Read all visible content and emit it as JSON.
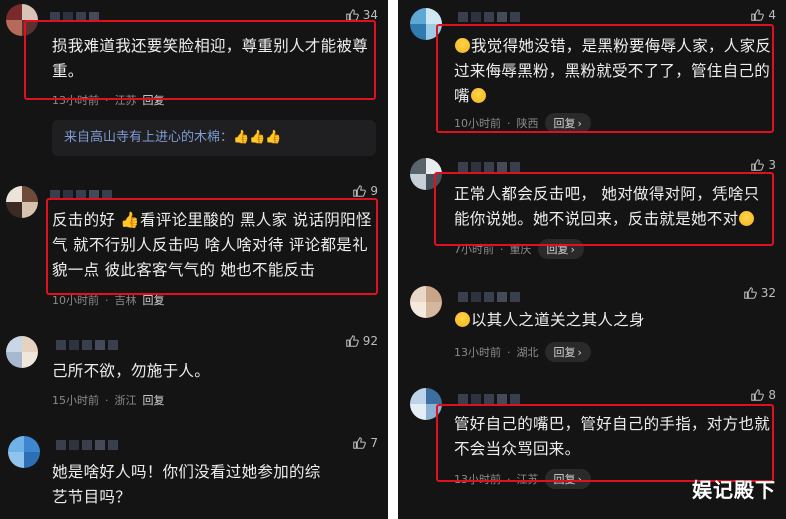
{
  "left": {
    "comments": [
      {
        "likes": "34",
        "text": "损我难道我还要笑脸相迎，尊重别人才能被尊重。",
        "time": "13小时前",
        "location": "江苏",
        "reply": "回复",
        "subreply": {
          "author": "来自高山寺有上进心的木棉",
          "sep": "：",
          "body": "👍👍👍"
        }
      },
      {
        "likes": "9",
        "text": "反击的好 👍看评论里酸的 黑人家 说话阴阳怪气 就不行别人反击吗 啥人啥对待 评论都是礼貌一点 彼此客客气气的 她也不能反击",
        "time": "10小时前",
        "location": "吉林",
        "reply": "回复"
      },
      {
        "likes": "92",
        "text": "己所不欲，勿施于人。",
        "time": "15小时前",
        "location": "浙江",
        "reply": "回复"
      },
      {
        "likes": "7",
        "text": "她是啥好人吗！你们没看过她参加的综艺节目吗？"
      }
    ]
  },
  "right": {
    "comments": [
      {
        "likes": "4",
        "text_a": "我觉得她没错，是黑粉要侮辱人家，人家反过来侮辱黑粉，黑粉就受不了了，管住自己的嘴",
        "time": "10小时前",
        "location": "陕西",
        "reply": "回复"
      },
      {
        "likes": "3",
        "text": "正常人都会反击吧， 她对做得对阿，凭啥只能你说她。她不说回来，反击就是她不对",
        "time": "7小时前",
        "location": "重庆",
        "reply": "回复"
      },
      {
        "likes": "32",
        "text": "以其人之道关之其人之身",
        "time": "13小时前",
        "location": "湖北",
        "reply": "回复"
      },
      {
        "likes": "8",
        "text": "管好自己的嘴巴，管好自己的手指，对方也就不会当众骂回来。",
        "time": "13小时前",
        "location": "江苏",
        "reply": "回复"
      }
    ]
  },
  "watermark": "娱记殿下"
}
